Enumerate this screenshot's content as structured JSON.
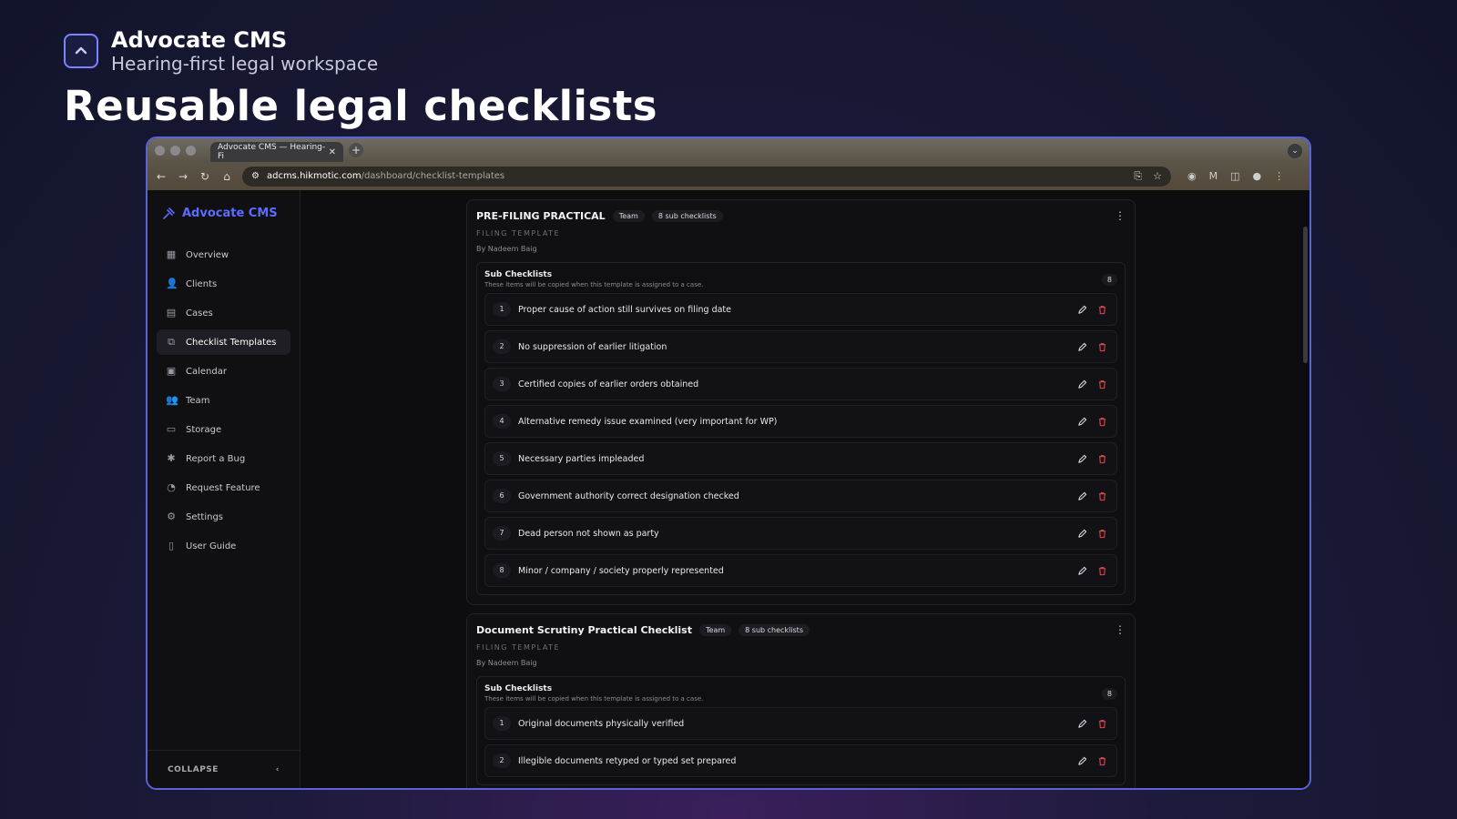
{
  "header": {
    "brand_title": "Advocate CMS",
    "brand_subtitle": "Hearing-first legal workspace",
    "hero": "Reusable legal checklists"
  },
  "browser": {
    "tab_title": "Advocate CMS — Hearing-Fi",
    "url_host": "adcms.hikmotic.com",
    "url_path": "/dashboard/checklist-templates"
  },
  "sidebar": {
    "brand": "Advocate CMS",
    "items": [
      {
        "label": "Overview",
        "icon": "grid-icon"
      },
      {
        "label": "Clients",
        "icon": "users-icon"
      },
      {
        "label": "Cases",
        "icon": "briefcase-icon"
      },
      {
        "label": "Checklist Templates",
        "icon": "templates-icon",
        "active": true
      },
      {
        "label": "Calendar",
        "icon": "calendar-icon"
      },
      {
        "label": "Team",
        "icon": "team-icon"
      },
      {
        "label": "Storage",
        "icon": "storage-icon"
      },
      {
        "label": "Report a Bug",
        "icon": "bug-icon"
      },
      {
        "label": "Request Feature",
        "icon": "lightbulb-icon"
      },
      {
        "label": "Settings",
        "icon": "gear-icon"
      },
      {
        "label": "User Guide",
        "icon": "book-icon"
      }
    ],
    "collapse_label": "COLLAPSE"
  },
  "templates": [
    {
      "title": "PRE-FILING PRACTICAL",
      "scope": "Team",
      "count_label": "8 sub checklists",
      "kicker": "FILING TEMPLATE",
      "author": "By Nadeem Baig",
      "sub_title": "Sub Checklists",
      "sub_desc": "These items will be copied when this template is assigned to a case.",
      "sub_count": "8",
      "items": [
        {
          "n": "1",
          "text": "Proper cause of action still survives on filing date"
        },
        {
          "n": "2",
          "text": "No suppression of earlier litigation"
        },
        {
          "n": "3",
          "text": "Certified copies of earlier orders obtained"
        },
        {
          "n": "4",
          "text": "Alternative remedy issue examined (very important for WP)"
        },
        {
          "n": "5",
          "text": "Necessary parties impleaded"
        },
        {
          "n": "6",
          "text": "Government authority correct designation checked"
        },
        {
          "n": "7",
          "text": "Dead person not shown as party"
        },
        {
          "n": "8",
          "text": "Minor / company / society properly represented"
        }
      ]
    },
    {
      "title": "Document Scrutiny Practical Checklist",
      "scope": "Team",
      "count_label": "8 sub checklists",
      "kicker": "FILING TEMPLATE",
      "author": "By Nadeem Baig",
      "sub_title": "Sub Checklists",
      "sub_desc": "These items will be copied when this template is assigned to a case.",
      "sub_count": "8",
      "items": [
        {
          "n": "1",
          "text": "Original documents physically verified"
        },
        {
          "n": "2",
          "text": "Illegible documents retyped or typed set prepared"
        }
      ]
    }
  ],
  "colors": {
    "accent": "#5b6cff",
    "delete": "#e0464d",
    "border": "#5a63d8"
  }
}
